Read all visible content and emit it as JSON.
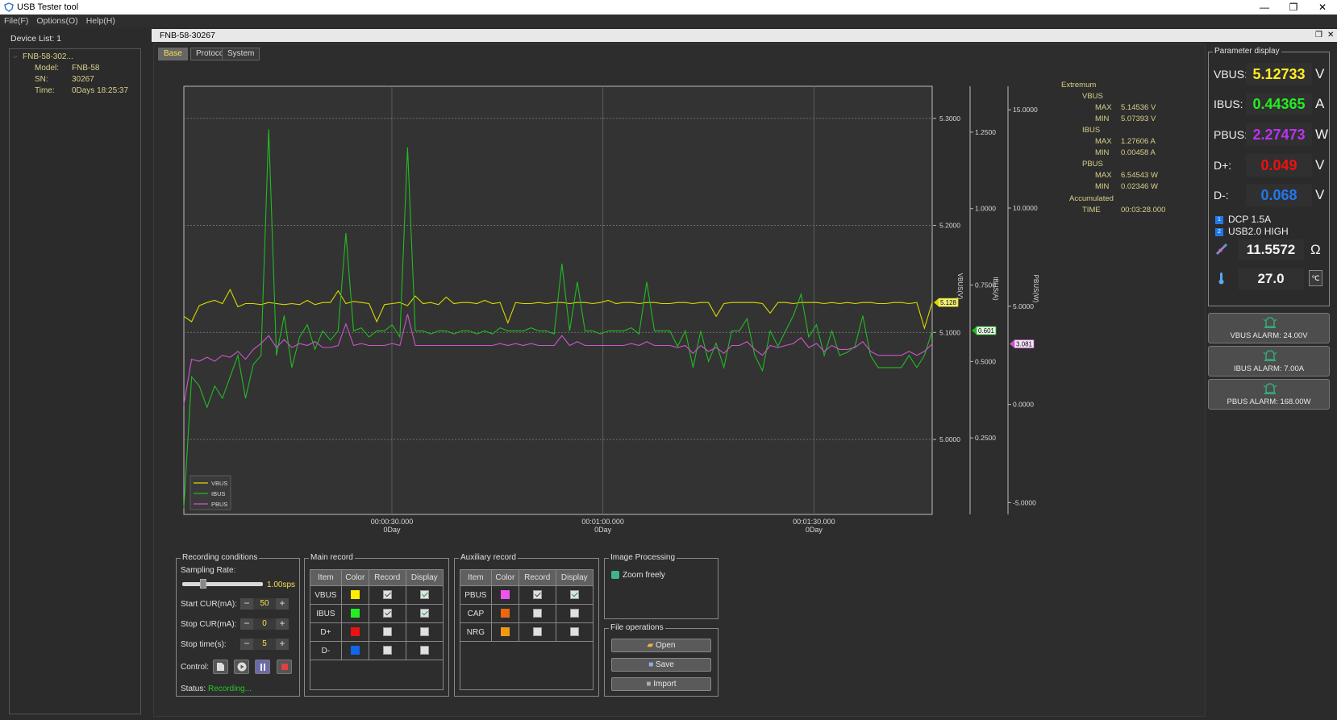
{
  "window": {
    "title": "USB Tester tool",
    "min": "—",
    "restore": "❐",
    "close": "✕"
  },
  "menu": [
    "File(F)",
    "Options(O)",
    "Help(H)"
  ],
  "device_list": {
    "header": "Device List: 1",
    "name": "FNB-58-302...",
    "rows": [
      {
        "key": "Model:",
        "val": "FNB-58"
      },
      {
        "key": "SN:",
        "val": "30267"
      },
      {
        "key": "Time:",
        "val": "0Days 18:25:37"
      }
    ]
  },
  "main": {
    "title": "FNB-58-30267",
    "tabs": [
      "Base",
      "Protocol",
      "System"
    ]
  },
  "chart_data": {
    "type": "line",
    "x_ticks": [
      {
        "label": "00:00:30.000",
        "sub": "0Day"
      },
      {
        "label": "00:01:00.000",
        "sub": "0Day"
      },
      {
        "label": "00:01:30.000",
        "sub": "0Day"
      }
    ],
    "axes": [
      {
        "name": "VBUS(V)",
        "ticks": [
          "5.3000",
          "5.2000",
          "5.1000",
          "5.0000"
        ],
        "ylim": [
          4.93,
          5.33
        ]
      },
      {
        "name": "IBUS(A)",
        "ticks": [
          "1.2500",
          "1.0000",
          "0.7500",
          "0.5000",
          "0.2500"
        ],
        "ylim": [
          0.0,
          1.4
        ]
      },
      {
        "name": "PBUS(W)",
        "ticks": [
          "15.0000",
          "10.0000",
          "5.0000",
          "0.0000",
          "-5.0000"
        ],
        "ylim": [
          -5.6,
          16.2
        ]
      }
    ],
    "markers": {
      "vbus": "5.128",
      "ibus": "0.601",
      "pbus": "3.081"
    },
    "series": [
      {
        "name": "VBUS",
        "color": "#d9d900",
        "values": [
          5.115,
          5.11,
          5.125,
          5.128,
          5.13,
          5.127,
          5.14,
          5.124,
          5.127,
          5.127,
          5.126,
          5.128,
          5.127,
          5.126,
          5.127,
          5.126,
          5.13,
          5.126,
          5.128,
          5.128,
          5.139,
          5.127,
          5.129,
          5.128,
          5.127,
          5.11,
          5.126,
          5.127,
          5.128,
          5.125,
          5.134,
          5.127,
          5.128,
          5.126,
          5.133,
          5.127,
          5.128,
          5.128,
          5.127,
          5.13,
          5.127,
          5.128,
          5.109,
          5.128,
          5.127,
          5.127,
          5.128,
          5.127,
          5.128,
          5.128,
          5.127,
          5.128,
          5.128,
          5.127,
          5.128,
          5.13,
          5.127,
          5.128,
          5.128,
          5.127,
          5.128,
          5.128,
          5.127,
          5.127,
          5.128,
          5.128,
          5.127,
          5.128,
          5.128,
          5.115,
          5.127,
          5.128,
          5.128,
          5.128,
          5.128,
          5.127,
          5.118,
          5.128,
          5.128,
          5.127,
          5.128,
          5.128,
          5.128,
          5.127,
          5.128,
          5.127,
          5.128,
          5.127,
          5.128,
          5.128,
          5.127,
          5.127,
          5.128,
          5.128,
          5.127,
          5.128,
          5.104,
          5.128
        ]
      },
      {
        "name": "IBUS",
        "color": "#22bb22",
        "values": [
          0.02,
          0.45,
          0.42,
          0.35,
          0.42,
          0.38,
          0.45,
          0.52,
          0.38,
          0.49,
          0.52,
          1.26,
          0.52,
          0.65,
          0.48,
          0.58,
          0.62,
          0.54,
          0.6,
          0.57,
          0.6,
          0.92,
          0.6,
          0.61,
          0.58,
          0.6,
          0.6,
          0.62,
          0.58,
          1.2,
          0.6,
          0.6,
          0.59,
          0.6,
          0.6,
          0.59,
          0.6,
          0.6,
          0.59,
          0.6,
          0.59,
          0.61,
          0.6,
          0.6,
          0.6,
          0.61,
          0.6,
          0.6,
          0.59,
          0.82,
          0.6,
          0.76,
          0.6,
          0.6,
          0.59,
          0.6,
          0.6,
          0.6,
          0.61,
          0.59,
          0.76,
          0.6,
          0.6,
          0.6,
          0.55,
          0.6,
          0.48,
          0.6,
          0.5,
          0.56,
          0.48,
          0.6,
          0.6,
          0.64,
          0.52,
          0.47,
          0.6,
          0.55,
          0.6,
          0.65,
          0.72,
          0.58,
          0.62,
          0.52,
          0.6,
          0.52,
          0.53,
          0.55,
          0.65,
          0.52,
          0.48,
          0.48,
          0.48,
          0.48,
          0.52,
          0.48,
          0.52,
          0.6
        ]
      },
      {
        "name": "PBUS",
        "color": "#cc55cc",
        "values": [
          0.0,
          2.3,
          2.2,
          2.4,
          2.2,
          2.5,
          2.4,
          2.7,
          2.3,
          2.8,
          3.1,
          3.5,
          2.9,
          3.3,
          2.9,
          3.1,
          3.0,
          3.2,
          2.9,
          2.9,
          3.0,
          4.1,
          3.0,
          3.1,
          3.0,
          3.0,
          3.0,
          3.1,
          3.0,
          4.6,
          3.0,
          3.0,
          3.0,
          3.0,
          3.0,
          3.0,
          3.0,
          3.0,
          3.0,
          3.0,
          3.0,
          3.1,
          3.0,
          3.1,
          3.0,
          3.1,
          3.0,
          3.0,
          3.0,
          3.5,
          3.0,
          3.2,
          3.0,
          3.0,
          3.0,
          3.0,
          3.0,
          3.0,
          3.1,
          3.0,
          3.2,
          3.0,
          3.0,
          3.0,
          2.9,
          3.0,
          2.6,
          3.0,
          2.7,
          2.9,
          2.6,
          3.0,
          3.0,
          3.2,
          2.8,
          2.5,
          3.0,
          2.9,
          3.0,
          3.1,
          3.4,
          2.9,
          3.1,
          2.7,
          3.0,
          2.8,
          2.8,
          2.9,
          3.2,
          2.7,
          2.5,
          2.5,
          2.5,
          2.5,
          2.7,
          2.5,
          2.7,
          3.081
        ]
      }
    ],
    "legend": [
      "VBUS",
      "IBUS",
      "PBUS"
    ]
  },
  "extremum": {
    "header": "Extremum",
    "vbus": "VBUS",
    "vbus_max_k": "MAX",
    "vbus_max": "5.14536 V",
    "vbus_min_k": "MIN",
    "vbus_min": "5.07393 V",
    "ibus": "IBUS",
    "ibus_max_k": "MAX",
    "ibus_max": "1.27606 A",
    "ibus_min_k": "MIN",
    "ibus_min": "0.00458 A",
    "pbus": "PBUS",
    "pbus_max_k": "MAX",
    "pbus_max": "6.54543 W",
    "pbus_min_k": "MIN",
    "pbus_min": "0.02346 W",
    "acc": "Accumulated",
    "time_k": "TIME",
    "time": "00:03:28.000"
  },
  "recording": {
    "title": "Recording conditions",
    "sampling_label": "Sampling Rate:",
    "sampling_value": "1.00sps",
    "start_label": "Start CUR(mA):",
    "start_val": "50",
    "stop_label": "Stop CUR(mA):",
    "stop_val": "0",
    "time_label": "Stop time(s):",
    "time_val": "5",
    "control_label": "Control:",
    "status_label": "Status:",
    "status_val": "Recording..."
  },
  "main_record": {
    "title": "Main record",
    "headers": [
      "Item",
      "Color",
      "Record",
      "Display"
    ],
    "rows": [
      {
        "item": "VBUS",
        "color": "#ffee00",
        "record": true,
        "display": true
      },
      {
        "item": "IBUS",
        "color": "#22ee22",
        "record": true,
        "display": true
      },
      {
        "item": "D+",
        "color": "#ee1111",
        "record": false,
        "display": false
      },
      {
        "item": "D-",
        "color": "#1166ee",
        "record": false,
        "display": false
      }
    ]
  },
  "aux_record": {
    "title": "Auxiliary record",
    "headers": [
      "Item",
      "Color",
      "Record",
      "Display"
    ],
    "rows": [
      {
        "item": "PBUS",
        "color": "#ee55ee",
        "record": true,
        "display": true
      },
      {
        "item": "CAP",
        "color": "#ee6611",
        "record": false,
        "display": false
      },
      {
        "item": "NRG",
        "color": "#ee9911",
        "record": false,
        "display": false
      }
    ]
  },
  "image_processing": {
    "title": "Image Processing",
    "zoom": "Zoom freely"
  },
  "file_ops": {
    "title": "File operations",
    "open": "Open",
    "save": "Save",
    "import": "Import"
  },
  "params": {
    "title": "Parameter display",
    "vbus": {
      "name": "VBUS:",
      "val": "5.12733",
      "unit": "V",
      "color": "#ffee22"
    },
    "ibus": {
      "name": "IBUS:",
      "val": "0.44365",
      "unit": "A",
      "color": "#22ee22"
    },
    "pbus": {
      "name": "PBUS:",
      "val": "2.27473",
      "unit": "W",
      "color": "#bb33ee"
    },
    "dp": {
      "name": "D+:",
      "val": "0.049",
      "unit": "V",
      "color": "#ee1111"
    },
    "dm": {
      "name": "D-:",
      "val": "0.068",
      "unit": "V",
      "color": "#2277ee"
    },
    "protocol1_num": "1",
    "protocol1": "DCP 1.5A",
    "protocol2_num": "2",
    "protocol2": "USB2.0 HIGH",
    "res_val": "11.5572",
    "res_unit": "Ω",
    "temp_val": "27.0",
    "temp_unit": "℃"
  },
  "alarms": [
    "VBUS ALARM: 24.00V",
    "IBUS ALARM: 7.00A",
    "PBUS ALARM: 168.00W"
  ]
}
